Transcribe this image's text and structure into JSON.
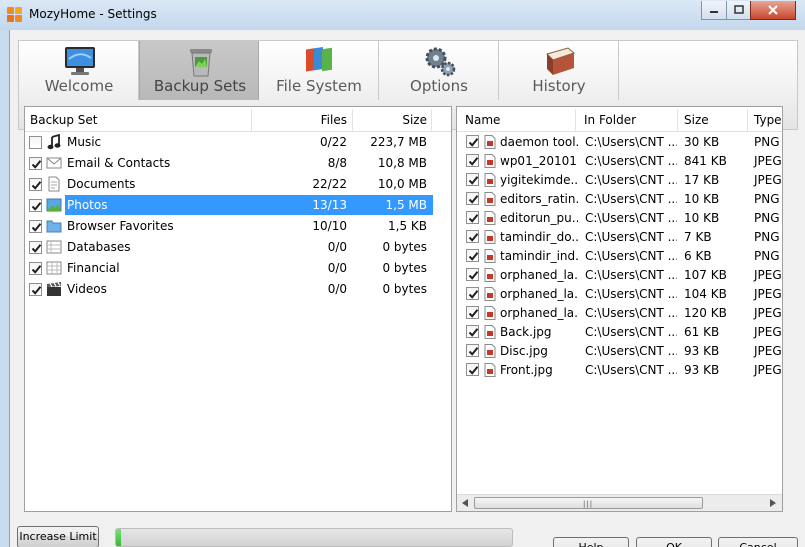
{
  "window": {
    "title": "MozyHome - Settings",
    "controls": [
      "minimize-icon",
      "maximize-icon",
      "close-icon"
    ]
  },
  "tabs": [
    {
      "id": "welcome",
      "label": "Welcome",
      "icon": "monitor-icon",
      "selected": false
    },
    {
      "id": "backup-sets",
      "label": "Backup Sets",
      "icon": "trash-bin-icon",
      "selected": true
    },
    {
      "id": "file-system",
      "label": "File System",
      "icon": "folders-icon",
      "selected": false
    },
    {
      "id": "options",
      "label": "Options",
      "icon": "gears-icon",
      "selected": false
    },
    {
      "id": "history",
      "label": "History",
      "icon": "book-icon",
      "selected": false
    }
  ],
  "backup_sets": {
    "headers": {
      "name": "Backup Set",
      "files": "Files",
      "size": "Size"
    },
    "rows": [
      {
        "name": "Music",
        "files": "0/22",
        "size": "223,7 MB",
        "checked": false,
        "icon": "music-note-icon",
        "selected": false
      },
      {
        "name": "Email & Contacts",
        "files": "8/8",
        "size": "10,8 MB",
        "checked": true,
        "icon": "envelope-icon",
        "selected": false
      },
      {
        "name": "Documents",
        "files": "22/22",
        "size": "10,0 MB",
        "checked": true,
        "icon": "document-icon",
        "selected": false
      },
      {
        "name": "Photos",
        "files": "13/13",
        "size": "1,5 MB",
        "checked": true,
        "icon": "photo-icon",
        "selected": true
      },
      {
        "name": "Browser Favorites",
        "files": "10/10",
        "size": "1,5 KB",
        "checked": true,
        "icon": "folder-icon",
        "selected": false
      },
      {
        "name": "Databases",
        "files": "0/0",
        "size": "0 bytes",
        "checked": true,
        "icon": "database-icon",
        "selected": false
      },
      {
        "name": "Financial",
        "files": "0/0",
        "size": "0 bytes",
        "checked": true,
        "icon": "spreadsheet-icon",
        "selected": false
      },
      {
        "name": "Videos",
        "files": "0/0",
        "size": "0 bytes",
        "checked": true,
        "icon": "clapperboard-icon",
        "selected": false
      }
    ]
  },
  "files": {
    "headers": {
      "name": "Name",
      "folder": "In Folder",
      "size": "Size",
      "type": "Type"
    },
    "rows": [
      {
        "name": "daemon tool...",
        "folder": "C:\\Users\\CNT ...",
        "size": "30 KB",
        "type": "PNG",
        "checked": true
      },
      {
        "name": "wp01_20101...",
        "folder": "C:\\Users\\CNT ...",
        "size": "841 KB",
        "type": "JPEG",
        "checked": true
      },
      {
        "name": "yigitekimde...",
        "folder": "C:\\Users\\CNT ...",
        "size": "17 KB",
        "type": "JPEG",
        "checked": true
      },
      {
        "name": "editors_ratin...",
        "folder": "C:\\Users\\CNT ...",
        "size": "10 KB",
        "type": "PNG",
        "checked": true
      },
      {
        "name": "editorun_pu...",
        "folder": "C:\\Users\\CNT ...",
        "size": "10 KB",
        "type": "PNG",
        "checked": true
      },
      {
        "name": "tamindir_do...",
        "folder": "C:\\Users\\CNT ...",
        "size": "7 KB",
        "type": "PNG",
        "checked": true
      },
      {
        "name": "tamindir_ind...",
        "folder": "C:\\Users\\CNT ...",
        "size": "6 KB",
        "type": "PNG",
        "checked": true
      },
      {
        "name": "orphaned_la...",
        "folder": "C:\\Users\\CNT ...",
        "size": "107 KB",
        "type": "JPEG",
        "checked": true
      },
      {
        "name": "orphaned_la...",
        "folder": "C:\\Users\\CNT ...",
        "size": "104 KB",
        "type": "JPEG",
        "checked": true
      },
      {
        "name": "orphaned_la...",
        "folder": "C:\\Users\\CNT ...",
        "size": "120 KB",
        "type": "JPEG",
        "checked": true
      },
      {
        "name": "Back.jpg",
        "folder": "C:\\Users\\CNT ...",
        "size": "61 KB",
        "type": "JPEG",
        "checked": true
      },
      {
        "name": "Disc.jpg",
        "folder": "C:\\Users\\CNT ...",
        "size": "93 KB",
        "type": "JPEG",
        "checked": true
      },
      {
        "name": "Front.jpg",
        "folder": "C:\\Users\\CNT ...",
        "size": "93 KB",
        "type": "JPEG",
        "checked": true
      }
    ],
    "scroll_grip": "|||"
  },
  "footer": {
    "increase_limit": "Increase Limit",
    "progress_fraction": 0.012,
    "help": "Help",
    "ok": "OK",
    "cancel": "Cancel"
  },
  "colors": {
    "selection": "#3399ff",
    "progress": "#2bb52b",
    "close_button": "#c9472c"
  }
}
